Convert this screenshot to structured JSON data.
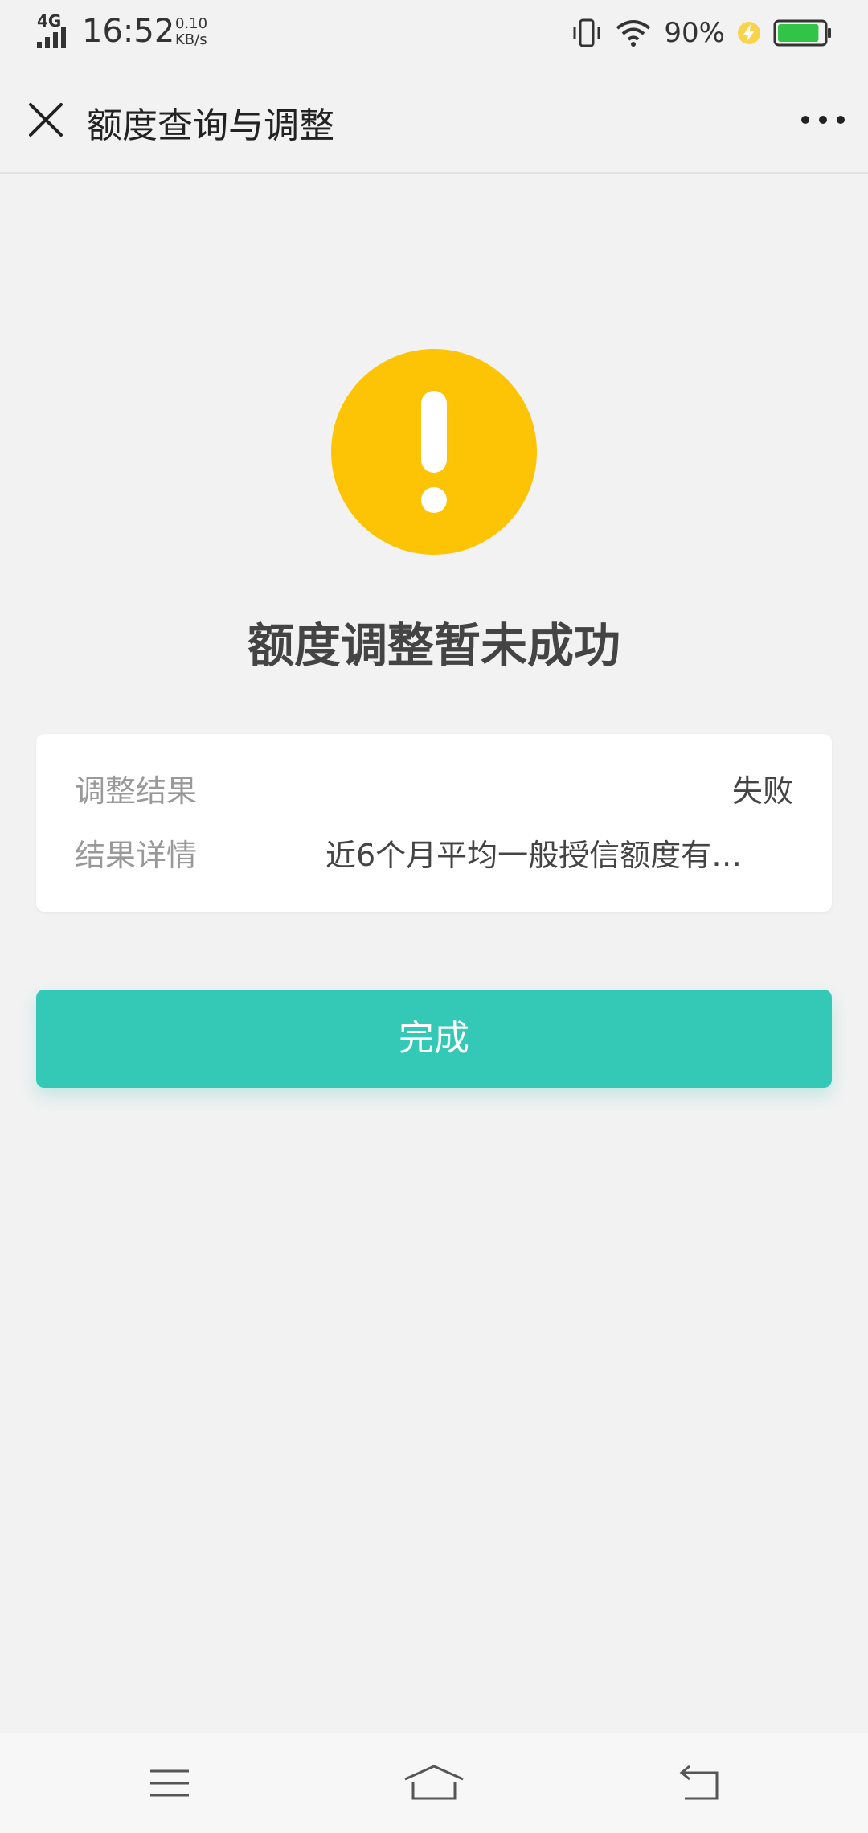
{
  "status_bar": {
    "network": "4G",
    "time": "16:52",
    "speed_value": "0.10",
    "speed_unit": "KB/s",
    "battery_percent": "90%",
    "battery_level": 0.9,
    "icons": [
      "signal-icon",
      "vibrate-icon",
      "wifi-icon",
      "charging-icon",
      "battery-icon"
    ]
  },
  "nav": {
    "title": "额度查询与调整",
    "close_icon": "close-icon",
    "more_icon": "more-icon"
  },
  "result": {
    "icon": "warning-icon",
    "accent_color": "#fdc406",
    "title": "额度调整暂未成功"
  },
  "details": [
    {
      "label": "调整结果",
      "value": "失败"
    },
    {
      "label": "结果详情",
      "value": "近6个月平均一般授信额度有…"
    }
  ],
  "actions": {
    "done_label": "完成",
    "done_color": "#33c9b6"
  },
  "system_nav": {
    "icons": [
      "menu-icon",
      "home-icon",
      "back-icon"
    ]
  }
}
